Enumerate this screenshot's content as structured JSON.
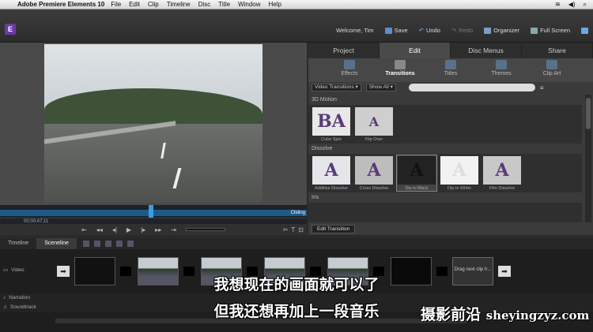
{
  "menubar": {
    "app": "Adobe Premiere Elements 10",
    "items": [
      "File",
      "Edit",
      "Clip",
      "Timeline",
      "Disc",
      "Title",
      "Window",
      "Help"
    ]
  },
  "header": {
    "welcome": "Welcome, Tim",
    "save": "Save",
    "undo": "Undo",
    "redo": "Redo",
    "organizer": "Organizer",
    "fullscreen": "Full Screen"
  },
  "monitor": {
    "timecode": "00;00;47;11",
    "clip_label": "Cliding"
  },
  "panel": {
    "tabs": [
      "Project",
      "Edit",
      "Disc Menus",
      "Share"
    ],
    "subtabs": [
      "Effects",
      "Transitions",
      "Titles",
      "Themes",
      "Clip Art"
    ],
    "filter1": "Video Transitions",
    "filter2": "Show All",
    "cat1": "3D Motion",
    "cat1_items": [
      "Cube Spin",
      "Flip Over"
    ],
    "cat2": "Dissolve",
    "cat2_items": [
      "Additive Dissolve",
      "Cross Dissolve",
      "Dip to Black",
      "Dip to White",
      "Film Dissolve"
    ],
    "cat3": "Iris",
    "edit_transition": "Edit Transition"
  },
  "timeline": {
    "tabs": [
      "Timeline",
      "Sceneline"
    ],
    "video": "Video",
    "narration": "Narration",
    "soundtrack": "Soundtrack",
    "drag_next": "Drag next clip h..."
  },
  "subtitles": {
    "line1": "我想现在的画面就可以了",
    "line2": "但我还想再加上一段音乐"
  },
  "watermark": {
    "cn": "摄影前沿",
    "url": "sheyingzyz.com"
  }
}
